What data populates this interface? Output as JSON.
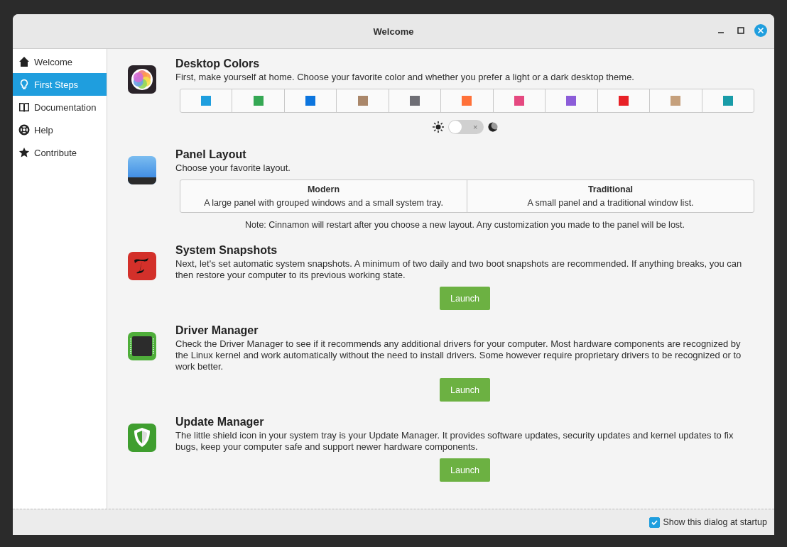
{
  "window": {
    "title": "Welcome"
  },
  "sidebar": {
    "items": [
      {
        "label": "Welcome",
        "selected": false
      },
      {
        "label": "First Steps",
        "selected": true
      },
      {
        "label": "Documentation",
        "selected": false
      },
      {
        "label": "Help",
        "selected": false
      },
      {
        "label": "Contribute",
        "selected": false
      }
    ]
  },
  "sections": [
    {
      "kind": "colors",
      "title": "Desktop Colors",
      "description": "First, make yourself at home. Choose your favorite color and whether you prefer a light or a dark desktop theme.",
      "swatches": [
        {
          "color": "#1f9ede"
        },
        {
          "color": "#35a854"
        },
        {
          "color": "#0c75de"
        },
        {
          "color": "#aa876a"
        },
        {
          "color": "#6e6e75"
        },
        {
          "color": "#ff7139"
        },
        {
          "color": "#e54980"
        },
        {
          "color": "#8c5dd9"
        },
        {
          "color": "#e82127"
        },
        {
          "color": "#c5a07c"
        },
        {
          "color": "#199ca8"
        }
      ],
      "dark_mode": {
        "on": false,
        "off_glyph": "×"
      }
    },
    {
      "kind": "layout",
      "title": "Panel Layout",
      "description": "Choose your favorite layout.",
      "options": [
        {
          "title": "Modern",
          "description": "A large panel with grouped windows and a small system tray."
        },
        {
          "title": "Traditional",
          "description": "A small panel and a traditional window list."
        }
      ],
      "note": "Note: Cinnamon will restart after you choose a new layout. Any customization you made to the panel will be lost."
    },
    {
      "kind": "launch",
      "title": "System Snapshots",
      "description": "Next, let's set automatic system snapshots. A minimum of two daily and two boot snapshots are recommended. If anything breaks, you can then restore your computer to its previous working state.",
      "button": "Launch"
    },
    {
      "kind": "launch",
      "title": "Driver Manager",
      "description": "Check the Driver Manager to see if it recommends any additional drivers for your computer. Most hardware components are recognized by the Linux kernel and work automatically without the need to install drivers. Some however require proprietary drivers to be recognized or to work better.",
      "button": "Launch"
    },
    {
      "kind": "launch",
      "title": "Update Manager",
      "description": "The little shield icon in your system tray is your Update Manager. It provides software updates, security updates and kernel updates to fix bugs, keep your computer safe and support newer hardware components.",
      "button": "Launch"
    }
  ],
  "footer": {
    "startup_checkbox": {
      "label": "Show this dialog at startup",
      "checked": true
    }
  }
}
